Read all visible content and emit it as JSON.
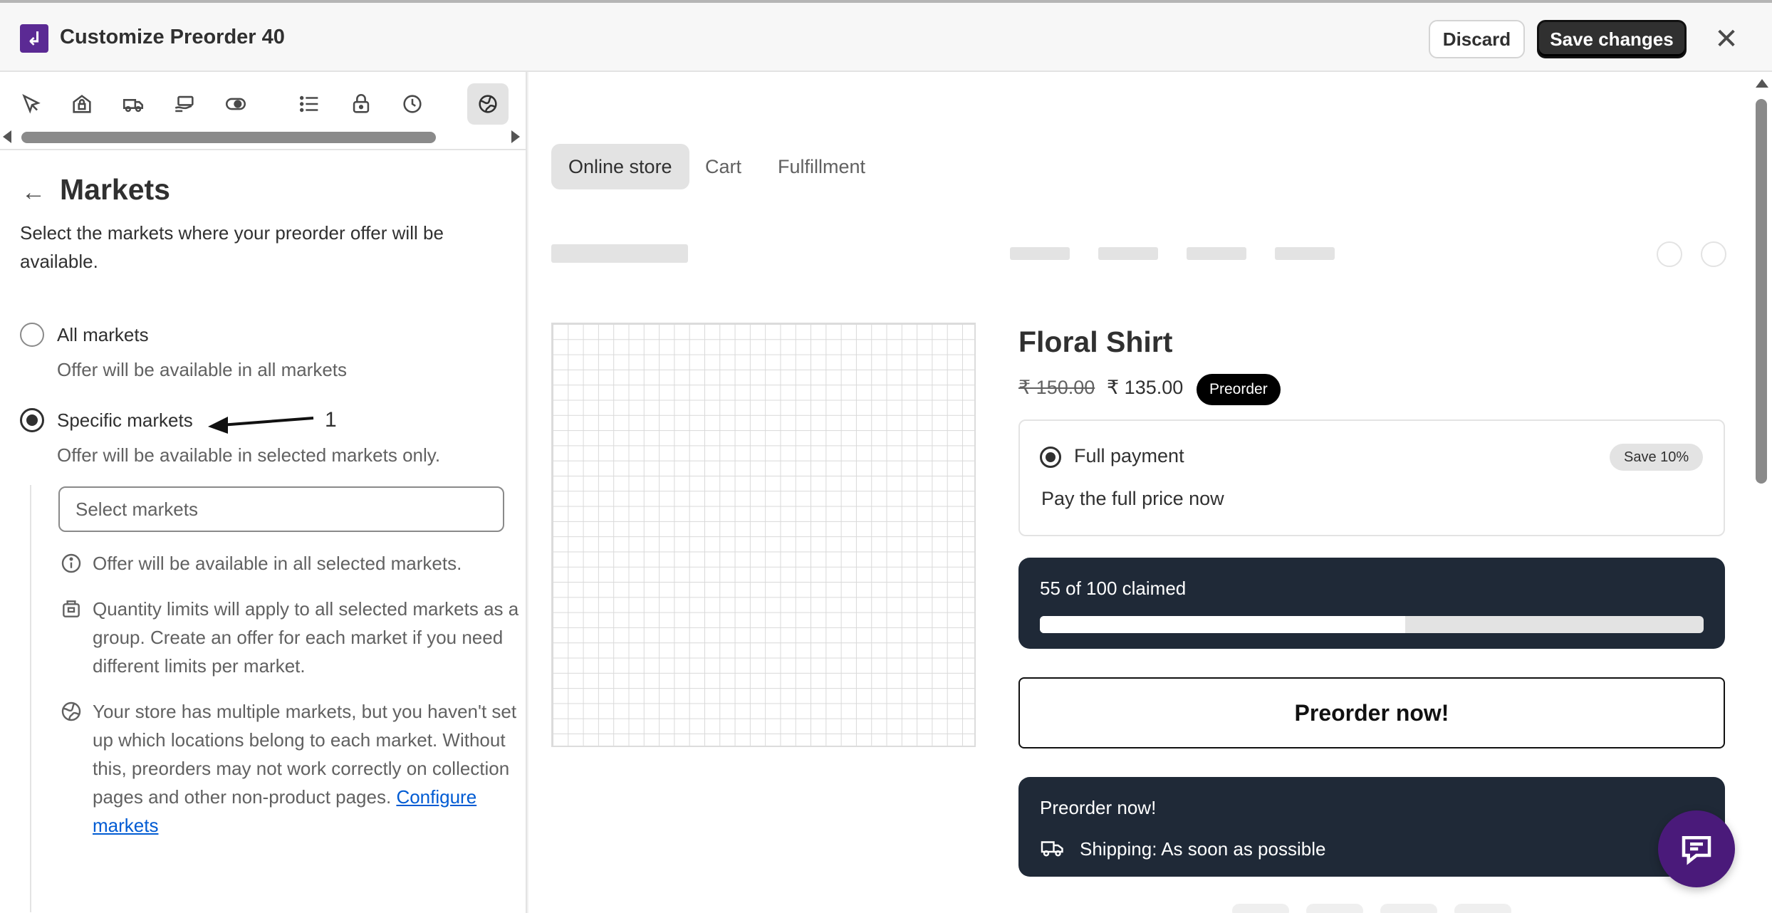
{
  "topbar": {
    "title": "Customize Preorder 40",
    "discard_label": "Discard",
    "save_label": "Save changes",
    "close_icon": "close-icon"
  },
  "toolbar": {
    "icons": [
      "cursor-click-icon",
      "store-lock-icon",
      "delivery-truck-icon",
      "hand-payment-icon",
      "toggle-icon",
      "list-icon",
      "lock-icon",
      "clock-icon",
      "globe-icon"
    ],
    "active_icon": "globe-icon"
  },
  "panel": {
    "title": "Markets",
    "description": "Select the markets where your preorder offer will be available.",
    "options": [
      {
        "label": "All markets",
        "help": "Offer will be available in all markets",
        "checked": false
      },
      {
        "label": "Specific markets",
        "help": "Offer will be available in selected markets only.",
        "checked": true
      }
    ],
    "annotation_number": "1",
    "select_placeholder": "Select markets",
    "info": [
      {
        "icon": "info-icon",
        "text": "Offer will be available in all selected markets."
      },
      {
        "icon": "inventory-icon",
        "text": "Quantity limits will apply to all selected markets as a group. Create an offer for each market if you need different limits per market."
      },
      {
        "icon": "globe-icon",
        "text": "Your store has multiple markets, but you haven't set up which locations belong to each market. Without this, preorders may not work correctly on collection pages and other non-product pages. ",
        "link": "Configure markets"
      }
    ]
  },
  "preview": {
    "tabs": [
      "Online store",
      "Cart",
      "Fulfillment"
    ],
    "active_tab": "Online store",
    "product": {
      "title": "Floral Shirt",
      "price_old": "₹ 150.00",
      "price_new": "₹ 135.00",
      "badge": "Preorder"
    },
    "payment": {
      "label": "Full payment",
      "badge": "Save 10%",
      "help": "Pay the full price now"
    },
    "claimed": {
      "text": "55 of 100 claimed",
      "fraction": 0.55
    },
    "preorder_button": "Preorder now!",
    "shipping": {
      "title": "Preorder now!",
      "text": "Shipping: As soon as possible"
    }
  },
  "colors": {
    "brand": "#5b2a94",
    "dark_card": "#1f2937",
    "link": "#005bd3",
    "chat": "#4a1a7a"
  }
}
